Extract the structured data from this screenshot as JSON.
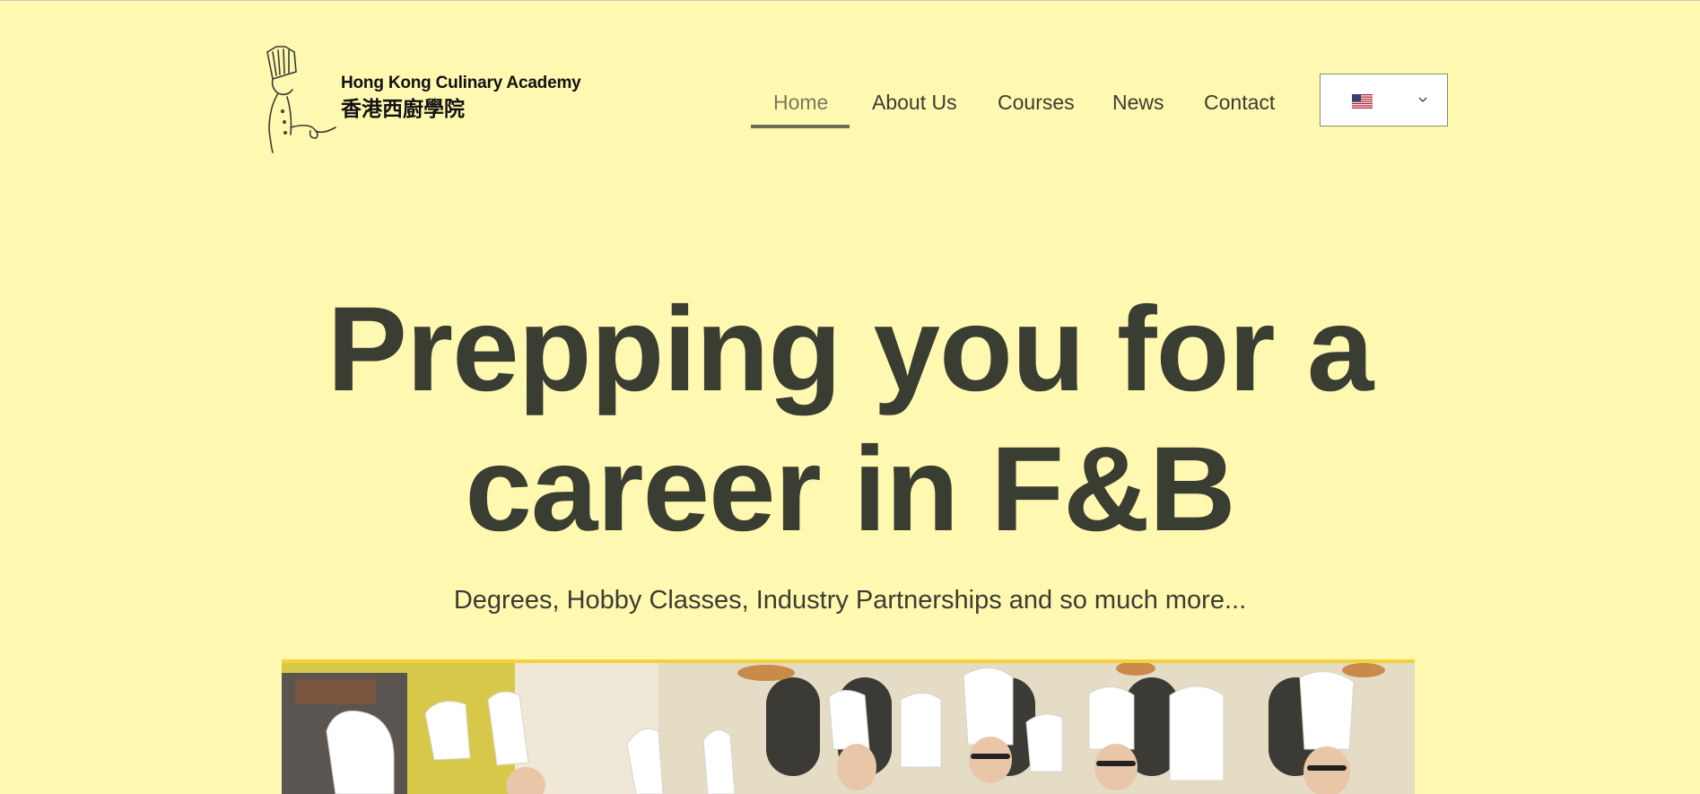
{
  "header": {
    "brand_en": "Hong Kong Culinary Academy",
    "brand_zh": "香港西廚學院",
    "nav": [
      {
        "label": "Home",
        "active": true
      },
      {
        "label": "About Us",
        "active": false
      },
      {
        "label": "Courses",
        "active": false
      },
      {
        "label": "News",
        "active": false
      },
      {
        "label": "Contact",
        "active": false
      }
    ],
    "language_selector": {
      "flag": "us-flag-icon"
    }
  },
  "hero": {
    "title_line1": "Prepping you for a",
    "title_line2": "career in F&B",
    "subtitle": "Degrees, Hobby Classes, Industry Partnerships and so much more..."
  },
  "colors": {
    "background": "#fff8b0",
    "text": "#3a3d32",
    "nav_active": "#7b7a5b",
    "underline": "#6d6c52"
  },
  "icons": [
    "chef-logo-icon",
    "us-flag-icon",
    "chevron-down-icon"
  ]
}
